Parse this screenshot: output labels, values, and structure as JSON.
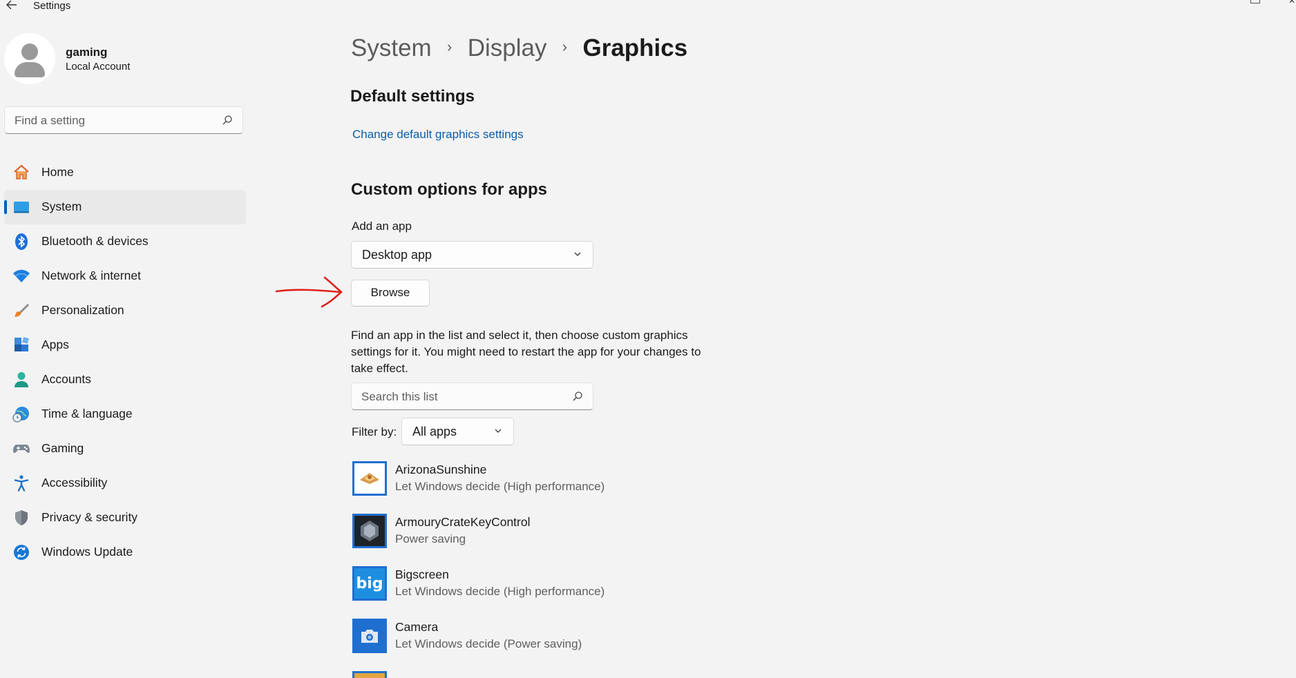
{
  "window": {
    "title": "Settings",
    "back_icon": "back-arrow-icon"
  },
  "profile": {
    "name": "gaming",
    "account_type": "Local Account"
  },
  "search": {
    "placeholder": "Find a setting"
  },
  "sidebar": {
    "items": [
      {
        "label": "Home",
        "icon": "home-icon"
      },
      {
        "label": "System",
        "icon": "system-icon",
        "active": true
      },
      {
        "label": "Bluetooth & devices",
        "icon": "bluetooth-icon"
      },
      {
        "label": "Network & internet",
        "icon": "wifi-icon"
      },
      {
        "label": "Personalization",
        "icon": "brush-icon"
      },
      {
        "label": "Apps",
        "icon": "apps-icon"
      },
      {
        "label": "Accounts",
        "icon": "account-icon"
      },
      {
        "label": "Time & language",
        "icon": "globe-clock-icon"
      },
      {
        "label": "Gaming",
        "icon": "gamepad-icon"
      },
      {
        "label": "Accessibility",
        "icon": "accessibility-icon"
      },
      {
        "label": "Privacy & security",
        "icon": "shield-icon"
      },
      {
        "label": "Windows Update",
        "icon": "update-icon"
      }
    ]
  },
  "breadcrumb": [
    "System",
    "Display",
    "Graphics"
  ],
  "default_settings": {
    "heading": "Default settings",
    "link": "Change default graphics settings"
  },
  "custom_options": {
    "heading": "Custom options for apps",
    "add_app_label": "Add an app",
    "app_type_selected": "Desktop app",
    "browse_label": "Browse",
    "description": "Find an app in the list and select it, then choose custom graphics settings for it. You might need to restart the app for your changes to take effect.",
    "list_search_placeholder": "Search this list",
    "filter_label": "Filter by:",
    "filter_selected": "All apps"
  },
  "apps": [
    {
      "name": "ArizonaSunshine",
      "preference": "Let Windows decide (High performance)",
      "icon": "arizona-sunshine-icon"
    },
    {
      "name": "ArmouryCrateKeyControl",
      "preference": "Power saving",
      "icon": "armoury-crate-icon"
    },
    {
      "name": "Bigscreen",
      "preference": "Let Windows decide (High performance)",
      "icon": "bigscreen-icon",
      "icon_text": "big"
    },
    {
      "name": "Camera",
      "preference": "Let Windows decide (Power saving)",
      "icon": "camera-icon"
    }
  ],
  "colors": {
    "accent": "#005fb8",
    "link": "#0b5cad",
    "background": "#f3f3f3",
    "annotation_arrow": "#e0201c"
  }
}
